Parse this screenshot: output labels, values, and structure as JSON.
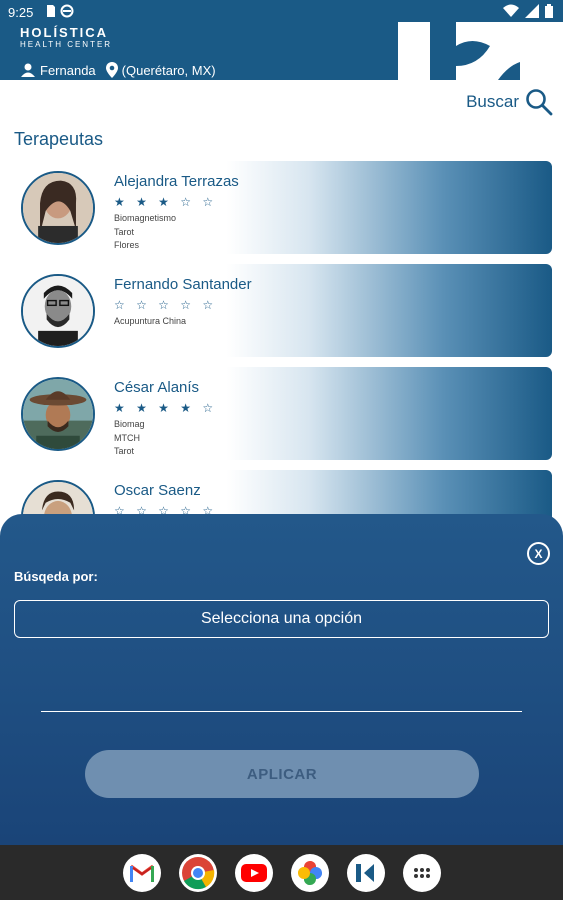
{
  "status": {
    "time": "9:25"
  },
  "brand": {
    "line1": "HOLÍSTICA",
    "line2": "HEALTH CENTER"
  },
  "user": {
    "name": "Fernanda",
    "location": "(Querétaro, MX)"
  },
  "search": {
    "label": "Buscar"
  },
  "section": {
    "title": "Terapeutas"
  },
  "therapists": [
    {
      "name": "Alejandra Terrazas",
      "stars": "★ ★ ★ ☆ ☆",
      "rating": 3,
      "specialties": [
        "Biomagnetismo",
        "Tarot",
        "Flores"
      ]
    },
    {
      "name": "Fernando Santander",
      "stars": "☆ ☆ ☆ ☆ ☆",
      "rating": 0,
      "specialties": [
        "Acupuntura China"
      ]
    },
    {
      "name": "César  Alanís",
      "stars": "★ ★ ★ ★ ☆",
      "rating": 4,
      "specialties": [
        "Biomag",
        "MTCH",
        "Tarot"
      ]
    },
    {
      "name": "Oscar  Saenz",
      "stars": "☆ ☆ ☆ ☆ ☆",
      "rating": 0,
      "specialties": []
    }
  ],
  "sheet": {
    "close_label": "X",
    "filter_label": "Búsqeda por:",
    "select_value": "Selecciona una opción",
    "apply_label": "APLICAR"
  },
  "navbar": {
    "apps": [
      "gmail-icon",
      "chrome-icon",
      "youtube-icon",
      "photos-icon",
      "holistica-icon",
      "app-drawer-icon"
    ]
  },
  "colors": {
    "primary": "#1a5a86",
    "sheet": "#1f4f82",
    "apply_disabled": "#6f8fb0"
  }
}
